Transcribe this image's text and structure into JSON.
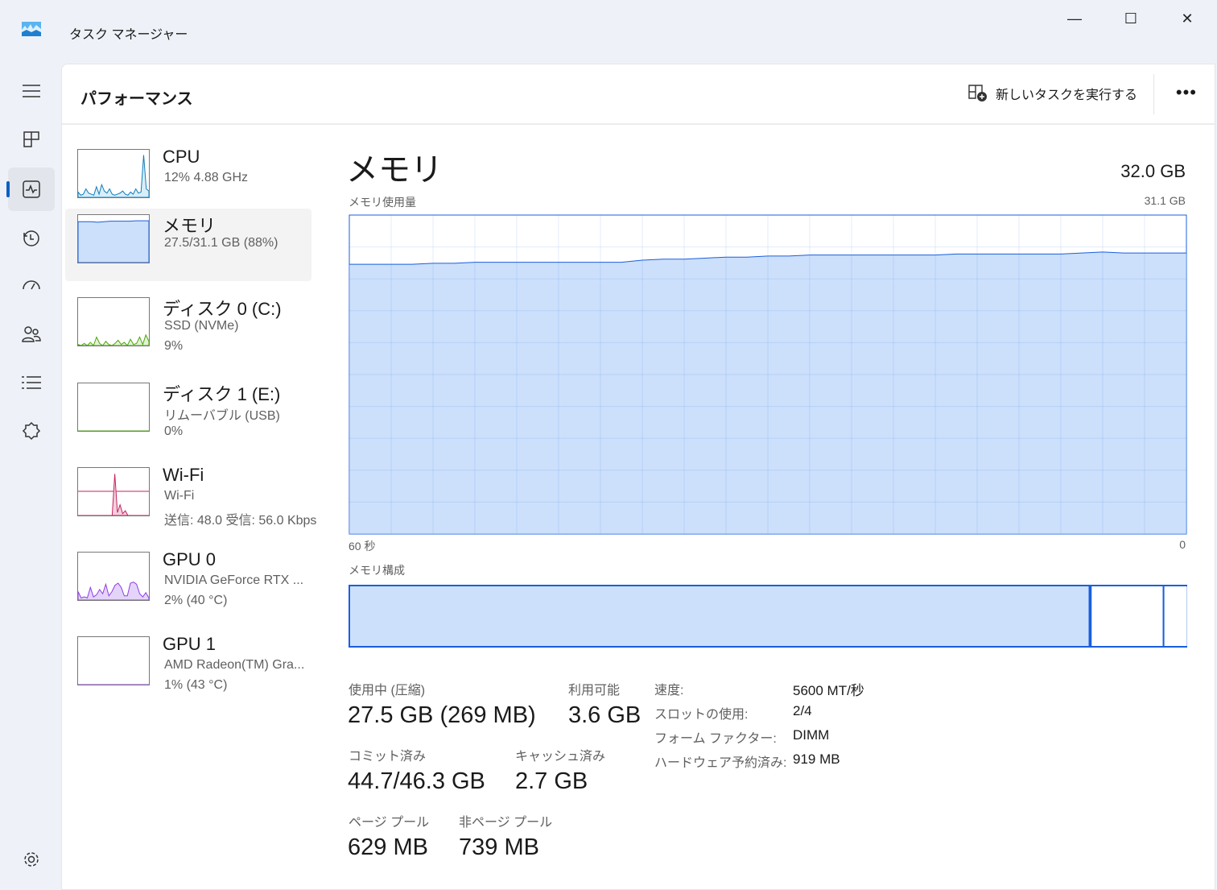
{
  "window": {
    "title": "タスク マネージャー",
    "minimize": "—",
    "maximize": "☐",
    "close": "✕"
  },
  "nav": {
    "items": [
      "menu-icon",
      "processes-icon",
      "performance-icon",
      "app-history-icon",
      "startup-icon",
      "users-icon",
      "details-icon",
      "services-icon",
      "settings-icon"
    ]
  },
  "header": {
    "title": "パフォーマンス",
    "run_task": "新しいタスクを実行する",
    "more": "•••"
  },
  "sidebar": [
    {
      "name": "CPU",
      "line1": "12%  4.88 GHz",
      "line2": "",
      "color": "#117dbb",
      "fill": "#d8eef8",
      "spark": [
        5,
        2,
        3,
        8,
        4,
        3,
        2,
        10,
        3,
        12,
        6,
        4,
        8,
        3,
        2,
        3,
        4,
        6,
        3,
        2,
        5,
        3,
        8,
        4,
        5,
        40,
        8,
        6
      ]
    },
    {
      "name": "メモリ",
      "line1": "27.5/31.1 GB (88%)",
      "line2": "",
      "color": "#1a5fdc",
      "fill": "#cce0fc",
      "spark": [
        86,
        86,
        86,
        85,
        86,
        87,
        87,
        87,
        87,
        88,
        88,
        88
      ]
    },
    {
      "name": "ディスク 0 (C:)",
      "line1": "SSD (NVMe)",
      "line2": "9%",
      "color": "#4da60c",
      "fill": "#e3f2d6",
      "spark": [
        1,
        0,
        2,
        0,
        3,
        0,
        8,
        2,
        0,
        4,
        1,
        0,
        2,
        5,
        1,
        3,
        0,
        6,
        1,
        2,
        8,
        1,
        10,
        4
      ]
    },
    {
      "name": "ディスク 1 (E:)",
      "line1": "リムーバブル (USB)",
      "line2": "0%",
      "color": "#4da60c",
      "fill": "#e3f2d6",
      "spark": [
        0,
        0,
        0
      ]
    },
    {
      "name": "Wi-Fi",
      "line1": "Wi-Fi",
      "line2": "送信: 48.0  受信: 56.0 Kbps",
      "color": "#c4225e",
      "fill": "#f4d0de",
      "spark": [
        0,
        0,
        0,
        0,
        0,
        0,
        0,
        0,
        0,
        0,
        0,
        0,
        0,
        0,
        70,
        5,
        18,
        3,
        8,
        0,
        0,
        0,
        0,
        0,
        0,
        0,
        0,
        0
      ]
    },
    {
      "name": "GPU 0",
      "line1": "NVIDIA GeForce RTX ...",
      "line2": "2%  (40 °C)",
      "color": "#8e3ce8",
      "fill": "#e4d4fa",
      "spark": [
        8,
        2,
        3,
        2,
        12,
        3,
        5,
        10,
        6,
        15,
        4,
        8,
        14,
        16,
        12,
        4,
        4,
        16,
        17,
        15,
        6,
        3,
        7,
        2
      ]
    },
    {
      "name": "GPU 1",
      "line1": "AMD Radeon(TM) Gra...",
      "line2": "1%  (43 °C)",
      "color": "#8e3ce8",
      "fill": "#e4d4fa",
      "spark": [
        0,
        0,
        0
      ]
    }
  ],
  "detail": {
    "title": "メモリ",
    "total": "32.0 GB",
    "usage_label": "メモリ使用量",
    "max_label": "31.1 GB",
    "time_left": "60 秒",
    "time_right": "0",
    "composition_label": "メモリ構成",
    "stats": [
      {
        "label": "使用中 (圧縮)",
        "value": "27.5 GB (269 MB)"
      },
      {
        "label": "利用可能",
        "value": "3.6 GB"
      },
      {
        "label": "コミット済み",
        "value": "44.7/46.3 GB"
      },
      {
        "label": "キャッシュ済み",
        "value": "2.7 GB"
      },
      {
        "label": "ページ プール",
        "value": "629 MB"
      },
      {
        "label": "非ページ プール",
        "value": "739 MB"
      }
    ],
    "props": [
      {
        "k": "速度:",
        "v": "5600 MT/秒"
      },
      {
        "k": "スロットの使用:",
        "v": "2/4"
      },
      {
        "k": "フォーム ファクター:",
        "v": "DIMM"
      },
      {
        "k": "ハードウェア予約済み:",
        "v": "919 MB"
      }
    ]
  },
  "chart_data": {
    "type": "area",
    "title": "メモリ使用量",
    "ylim": [
      0,
      31.1
    ],
    "xlim": [
      60,
      0
    ],
    "xlabel": "60 秒",
    "grid": true,
    "values": [
      26.3,
      26.3,
      26.3,
      26.3,
      26.4,
      26.4,
      26.5,
      26.5,
      26.5,
      26.5,
      26.5,
      26.5,
      26.5,
      26.5,
      26.7,
      26.8,
      26.8,
      26.9,
      27.0,
      27.0,
      27.1,
      27.1,
      27.2,
      27.2,
      27.2,
      27.2,
      27.2,
      27.2,
      27.2,
      27.3,
      27.3,
      27.3,
      27.3,
      27.3,
      27.3,
      27.4,
      27.5,
      27.4,
      27.4,
      27.4,
      27.4
    ],
    "composition": {
      "in_use_gb": 27.5,
      "modified_gb": 0.05,
      "standby_gb": 2.7,
      "free_gb": 0.9,
      "total_gb": 31.1
    }
  }
}
